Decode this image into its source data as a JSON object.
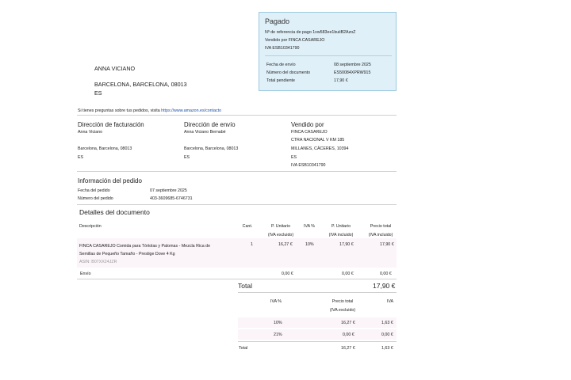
{
  "paid": {
    "title": "Pagado",
    "ref": "Nº de referencia de pago  1vw583ee1buiiB2AzoZ",
    "seller": "Vendido por FINCA CASAREJO",
    "vat": "IVA ESB10341790",
    "rows": [
      {
        "label": "Fecha de envío",
        "value": "08 septiembre 2025"
      },
      {
        "label": "Número del documento",
        "value": "ES50084XPRW915"
      },
      {
        "label": "Total pendiente",
        "value": "17,90 €"
      }
    ]
  },
  "customer": {
    "name": "ANNA VICIANO",
    "address": "BARCELONA, BARCELONA, 08013",
    "country": "ES"
  },
  "help": {
    "text": "Si tienes preguntas sobre tus pedidos, visita",
    "link": "https://www.amazon.es/contacto"
  },
  "billing": {
    "heading": "Dirección de facturación",
    "name": "Anna Viciano",
    "city": "Barcelona, Barcelona, 08013",
    "country": "ES"
  },
  "shipping": {
    "heading": "Dirección de envío",
    "name": "Anna Viciano Bernabé",
    "city": "Barcelona, Barcelona, 08013",
    "country": "ES"
  },
  "sold_by": {
    "heading": "Vendido por",
    "name": "FINCA CASAREJO",
    "street": "CTRA NACIONAL V KM 185",
    "city": "MILLANES, CÁCERES, 10394",
    "country": "ES",
    "vat": "IVA ESB10341790"
  },
  "order": {
    "heading": "Información del pedido",
    "date_label": "Fecha del pedido",
    "date_value": "07 septiembre 2025",
    "number_label": "Número del pedido",
    "number_value": "403-3609685-6746731"
  },
  "details": {
    "heading": "Detalles del documento",
    "headers": {
      "desc": "Descripción",
      "qty": "Cant.",
      "unit_excl_1": "P. Unitario",
      "unit_excl_2": "(IVA excluido)",
      "vat": "IVA %",
      "unit_incl_1": "P. Unitario",
      "unit_incl_2": "(IVA incluido)",
      "total_1": "Precio total",
      "total_2": "(IVA incluido)"
    },
    "item": {
      "desc_1": "FINCA CASAREJO Comida para Tórtolas y Palomas - Mezcla Rica de",
      "desc_2": "Semillas de Pequeño Tamaño - Prestige Dove 4 Kg",
      "asin": "ASIN: B07XX24JZR",
      "qty": "1",
      "unit_excl": "16,27 €",
      "vat": "10%",
      "unit_incl": "17,90 €",
      "total": "17,90 €"
    },
    "shipping": {
      "label": "Envío",
      "unit_excl": "0,00 €",
      "unit_incl": "0,00 €",
      "total": "0,00 €"
    },
    "total_label": "Total",
    "total_value": "17,90 €"
  },
  "vat_summary": {
    "header_rate": "IVA %",
    "header_base_1": "Precio total",
    "header_base_2": "(IVA excluido)",
    "header_vat": "IVA",
    "rows": [
      {
        "rate": "10%",
        "base": "16,27 €",
        "vat": "1,63 €"
      },
      {
        "rate": "21%",
        "base": "0,00 €",
        "vat": "0,00 €"
      }
    ],
    "total_label": "Total",
    "total_base": "16,27 €",
    "total_vat": "1,63 €"
  }
}
